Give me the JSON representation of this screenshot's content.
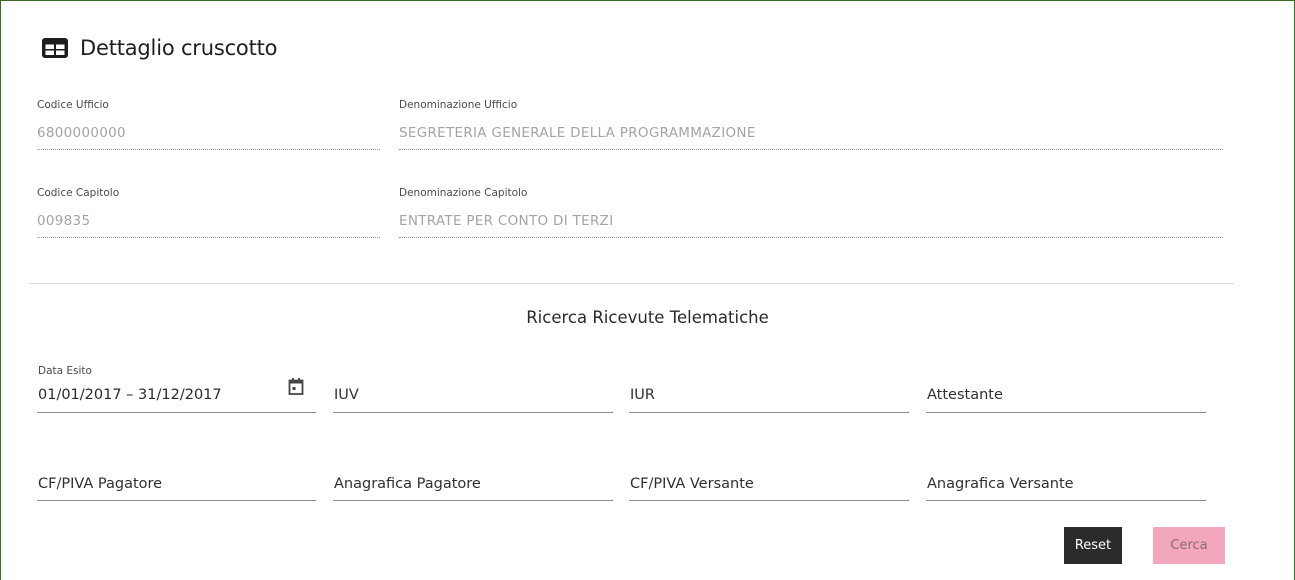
{
  "page": {
    "title": "Dettaglio cruscotto",
    "title_icon": "grid-table-icon"
  },
  "details": {
    "codice_ufficio": {
      "label": "Codice Ufficio",
      "value": "6800000000"
    },
    "denominazione_ufficio": {
      "label": "Denominazione Ufficio",
      "value": "SEGRETERIA GENERALE DELLA PROGRAMMAZIONE"
    },
    "codice_capitolo": {
      "label": "Codice Capitolo",
      "value": "009835"
    },
    "denominazione_capitolo": {
      "label": "Denominazione Capitolo",
      "value": "ENTRATE PER CONTO DI TERZI"
    }
  },
  "search": {
    "title": "Ricerca Ricevute Telematiche",
    "data_esito": {
      "label": "Data Esito",
      "value": "01/01/2017 – 31/12/2017",
      "icon": "calendar-icon"
    },
    "iuv": "IUV",
    "iur": "IUR",
    "attestante": "Attestante",
    "cf_piva_pagatore": "CF/PIVA Pagatore",
    "anagrafica_pagatore": "Anagrafica Pagatore",
    "cf_piva_versante": "CF/PIVA Versante",
    "anagrafica_versante": "Anagrafica Versante"
  },
  "buttons": {
    "reset": "Reset",
    "cerca": "Cerca"
  },
  "colors": {
    "frame": "#3b6b22",
    "reset_bg": "#2b2b2b",
    "cerca_bg": "#f3a6bc"
  }
}
